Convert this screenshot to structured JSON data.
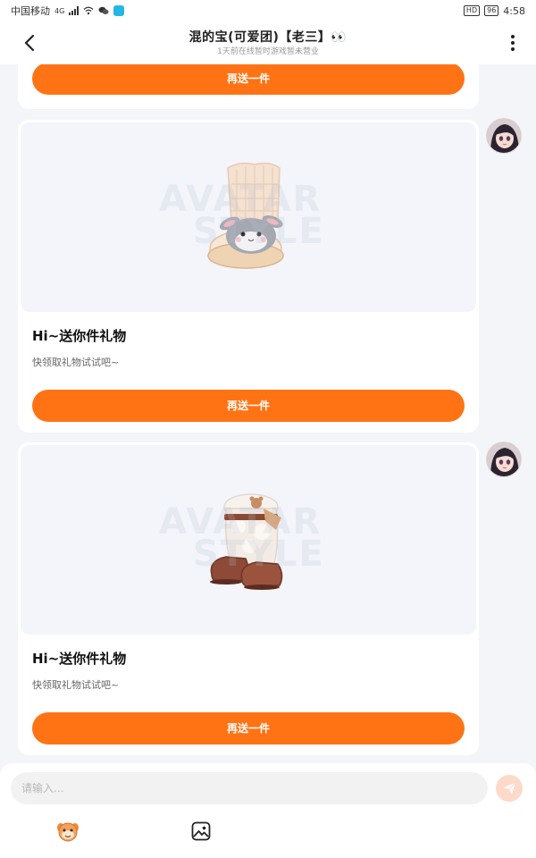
{
  "status_bar": {
    "carrier": "中国移动",
    "network": "4G",
    "hd": "HD",
    "battery": "96",
    "time": "4:58"
  },
  "header": {
    "title": "混的宝(可爱团)【老三】👀",
    "subtitle": "1天前在线暂时游戏暂未营业"
  },
  "gift_cards": [
    {
      "title": "Hi~送你件礼物",
      "desc": "快领取礼物试试吧~",
      "button_label": "再送一件"
    },
    {
      "title": "Hi~送你件礼物",
      "desc": "快领取礼物试试吧~",
      "button_label": "再送一件"
    }
  ],
  "partial_card": {
    "button_label": "再送一件"
  },
  "watermark": {
    "line1": "AVATAR",
    "line2": "STYLE"
  },
  "input": {
    "placeholder": "请输入..."
  },
  "colors": {
    "accent": "#ff7314",
    "send_disabled": "#fcd9c9",
    "background": "#f4f5f9"
  },
  "icons": {
    "back": "back-arrow-icon",
    "more": "more-vertical-icon",
    "send": "send-icon",
    "emoji": "mascot-emoji-icon",
    "image": "image-icon"
  }
}
